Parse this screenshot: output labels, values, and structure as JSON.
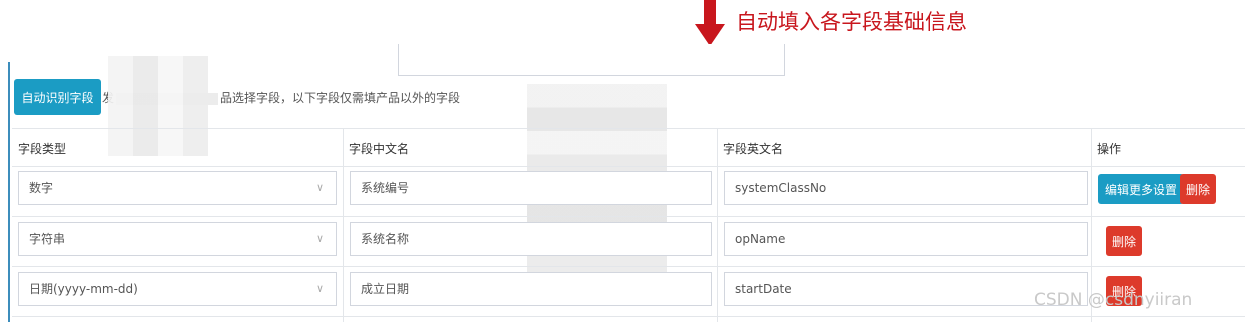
{
  "annotation": {
    "text": "自动填入各字段基础信息",
    "color": "#c8161d"
  },
  "toolbar": {
    "auto_button_label": "自动识别字段",
    "hint_prefix": "发",
    "hint_suffix": "品选择字段，以下字段仅需填产品以外的字段"
  },
  "table": {
    "headers": [
      "字段类型",
      "字段中文名",
      "字段英文名",
      "操作"
    ],
    "rows": [
      {
        "type": "数字",
        "cn_name": "系统编号",
        "en_name": "systemClassNo",
        "edit_label": "编辑更多设置",
        "delete_label": "删除"
      },
      {
        "type": "字符串",
        "cn_name": "系统名称",
        "en_name": "opName",
        "delete_label": "删除"
      },
      {
        "type": "日期(yyyy-mm-dd)",
        "cn_name": "成立日期",
        "en_name": "startDate",
        "delete_label": "删除"
      }
    ]
  },
  "watermark": "CSDN @csdnyiiran",
  "colors": {
    "accent": "#1b9cc4",
    "danger": "#dd3a2b",
    "border": "#d2d6de"
  },
  "icons": {
    "select_chevron": "chevron-down-icon",
    "annotation_arrow": "arrow-down-icon"
  }
}
